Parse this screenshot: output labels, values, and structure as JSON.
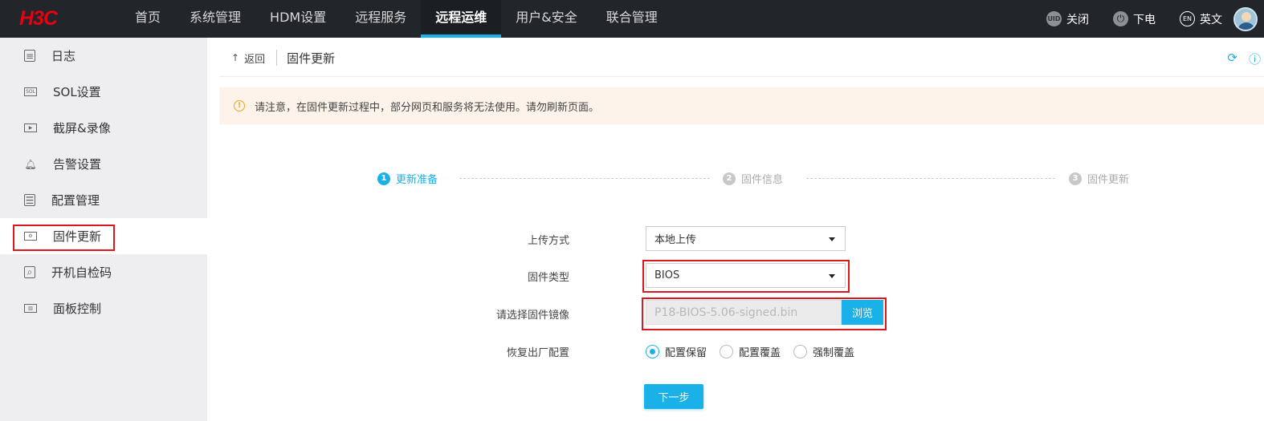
{
  "brand": {
    "logo_text": "H3C",
    "logo_color": "#e50012"
  },
  "topnav": {
    "items": [
      {
        "label": "首页",
        "active": false
      },
      {
        "label": "系统管理",
        "active": false
      },
      {
        "label": "HDM设置",
        "active": false
      },
      {
        "label": "远程服务",
        "active": false
      },
      {
        "label": "远程运维",
        "active": true
      },
      {
        "label": "用户&安全",
        "active": false
      },
      {
        "label": "联合管理",
        "active": false
      }
    ],
    "uid_icon_text": "UID",
    "uid_label": "关闭",
    "power_label": "下电",
    "lang_icon_text": "EN",
    "lang_label": "英文"
  },
  "sidebar": {
    "items": [
      {
        "label": "日志",
        "icon": "log-icon"
      },
      {
        "label": "SOL设置",
        "icon": "sol-icon",
        "icon_text": "SOL"
      },
      {
        "label": "截屏&录像",
        "icon": "video-icon"
      },
      {
        "label": "告警设置",
        "icon": "alarm-icon"
      },
      {
        "label": "配置管理",
        "icon": "config-icon"
      },
      {
        "label": "固件更新",
        "icon": "firmware-icon",
        "active": true
      },
      {
        "label": "开机自检码",
        "icon": "post-code-icon"
      },
      {
        "label": "面板控制",
        "icon": "panel-icon"
      }
    ]
  },
  "breadcrumb": {
    "back_label": "返回",
    "title": "固件更新"
  },
  "notice": {
    "text": "请注意，在固件更新过程中，部分网页和服务将无法使用。请勿刷新页面。"
  },
  "steps": [
    {
      "num": "1",
      "label": "更新准备",
      "active": true
    },
    {
      "num": "2",
      "label": "固件信息",
      "active": false
    },
    {
      "num": "3",
      "label": "固件更新",
      "active": false
    }
  ],
  "form": {
    "upload_method": {
      "label": "上传方式",
      "value": "本地上传"
    },
    "firmware_type": {
      "label": "固件类型",
      "value": "BIOS"
    },
    "firmware_image": {
      "label": "请选择固件镜像",
      "value": "P18-BIOS-5.06-signed.bin",
      "browse_label": "浏览"
    },
    "restore_config": {
      "label": "恢复出厂配置",
      "options": [
        {
          "label": "配置保留",
          "checked": true
        },
        {
          "label": "配置覆盖",
          "checked": false
        },
        {
          "label": "强制覆盖",
          "checked": false
        }
      ]
    },
    "next_label": "下一步"
  },
  "colors": {
    "accent": "#1ab1e8",
    "topbar": "#222529",
    "highlight": "#e0161e",
    "notice_bg": "#fdf3ea",
    "warning": "#f5a21e"
  }
}
